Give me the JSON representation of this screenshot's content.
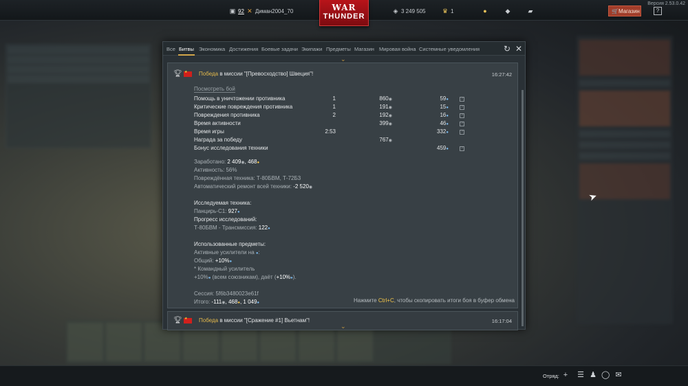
{
  "version": "Версия 2.53.0.42",
  "topbar": {
    "level": "92",
    "nickname": "Диман2004_70",
    "silver": "3 249 505",
    "eagles": "1",
    "logo_line1": "WAR",
    "logo_line2": "THUNDER",
    "shop_label": "Магазин",
    "help_label": "?"
  },
  "tabs": [
    "Все",
    "Битвы",
    "Экономика",
    "Достижения",
    "Боевые задачи",
    "Экипажи",
    "Предметы",
    "Магазин",
    "Мировая война",
    "Системные уведомления"
  ],
  "active_tab": "Битвы",
  "battle1": {
    "result": "Победа",
    "mission_text": " в миссии \"[Превосходство] Швеция\"!",
    "time": "16:27:42",
    "view_button": "Посмотреть бой",
    "stats": [
      {
        "label": "Помощь в уничтожении противника",
        "count": "1",
        "silver": "860",
        "rp": "59"
      },
      {
        "label": "Критические повреждения противника",
        "count": "1",
        "silver": "191",
        "rp": "15"
      },
      {
        "label": "Повреждения противника",
        "count": "2",
        "silver": "192",
        "rp": "16"
      },
      {
        "label": "Время активности",
        "count": "",
        "silver": "399",
        "rp": "46"
      },
      {
        "label": "Время игры",
        "count": "2:53",
        "silver": "",
        "rp": "332"
      },
      {
        "label": "Награда за победу",
        "count": "",
        "silver": "767",
        "rp": ""
      },
      {
        "label": "Бонус исследования техники",
        "count": "",
        "silver": "",
        "rp": "459"
      }
    ],
    "earned_label": "Заработано: ",
    "earned_silver": "2 409",
    "earned_rp": "468",
    "activity": "Активность: 56%",
    "damaged": "Повреждённая техника: Т-80БВМ, Т-72Б3",
    "auto_repair_label": "Автоматический ремонт всей техники: ",
    "auto_repair_value": "-2 520",
    "researched_title": "Исследуемая техника:",
    "researched_vehicle": "Панцирь-С1: ",
    "researched_rp": "927",
    "progress_title": "Прогресс исследований:",
    "progress_item": "Т-80БВМ - Трансмиссия: ",
    "progress_rp": "122",
    "used_items_title": "Использованные предметы:",
    "active_boosters": "Активные усилители на ",
    "active_boosters_end": ":",
    "general_label": "Общий: ",
    "general_value": "+10%",
    "command_booster": "* Командный усилитель",
    "command_line_a": "+10%",
    "command_line_b": " (всем союзникам), даёт (",
    "command_line_c": "+10%",
    "command_line_d": ").",
    "session": "Сессия: 5f6b3480023e61f",
    "total_label": "Итого: ",
    "total_silver": "-111",
    "total_rp": "468",
    "total_gold": "1 049",
    "copy_hint_a": "Нажмите ",
    "copy_hint_key": "Ctrl+C",
    "copy_hint_b": ", чтобы скопировать итоги боя в буфер обмена"
  },
  "battle2": {
    "result": "Победа",
    "mission_text": " в миссии \"[Сражение #1] Вьетнам\"!",
    "time": "16:17:04"
  },
  "bottombar": {
    "squad_label": "Отряд:"
  },
  "colors": {
    "accent_gold": "#e4b94c",
    "shop_red": "#a13d2a",
    "logo_red": "#b8141a",
    "rp_blue": "#79b6e8"
  },
  "icons": [
    "profile-icon",
    "crossed-swords-icon",
    "silver-lions-icon",
    "golden-eagle-icon",
    "bulb-icon",
    "warbond-icon",
    "ticket-icon",
    "cart-icon",
    "help-icon",
    "refresh-icon",
    "close-icon",
    "trophy-icon",
    "flag-icon",
    "plus-icon",
    "list-icon",
    "squad-icon",
    "chat-icon",
    "mail-icon"
  ]
}
